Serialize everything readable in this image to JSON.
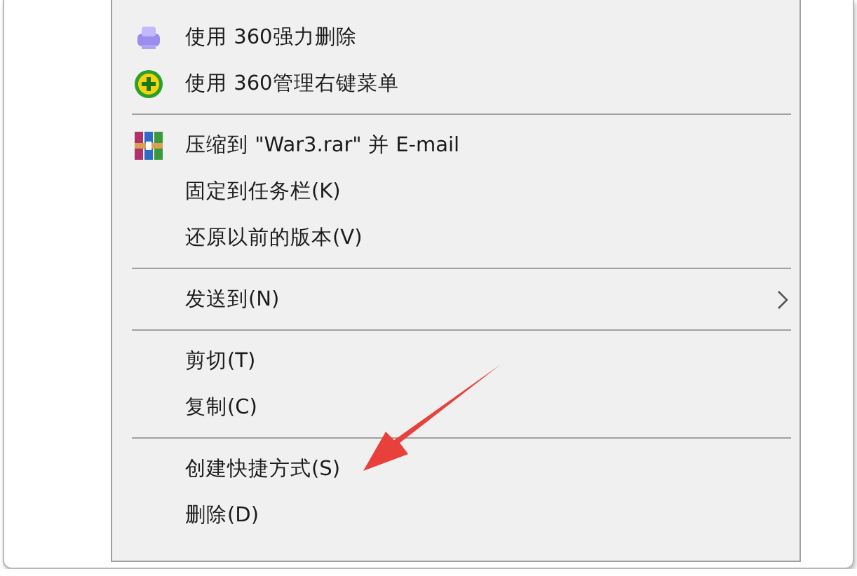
{
  "menu": {
    "items": [
      {
        "kind": "shred",
        "label": "使用 360强力删除"
      },
      {
        "kind": "manage",
        "label": "使用 360管理右键菜单"
      },
      {
        "kind": "separator"
      },
      {
        "kind": "archive",
        "label": "压缩到 \"War3.rar\" 并 E-mail"
      },
      {
        "kind": "plain",
        "label": "固定到任务栏(K)"
      },
      {
        "kind": "plain",
        "label": "还原以前的版本(V)"
      },
      {
        "kind": "separator"
      },
      {
        "kind": "submenu",
        "label": "发送到(N)"
      },
      {
        "kind": "separator"
      },
      {
        "kind": "plain",
        "label": "剪切(T)"
      },
      {
        "kind": "plain",
        "label": "复制(C)"
      },
      {
        "kind": "separator"
      },
      {
        "kind": "plain",
        "label": "创建快捷方式(S)"
      },
      {
        "kind": "plain",
        "label": "删除(D)"
      }
    ]
  }
}
